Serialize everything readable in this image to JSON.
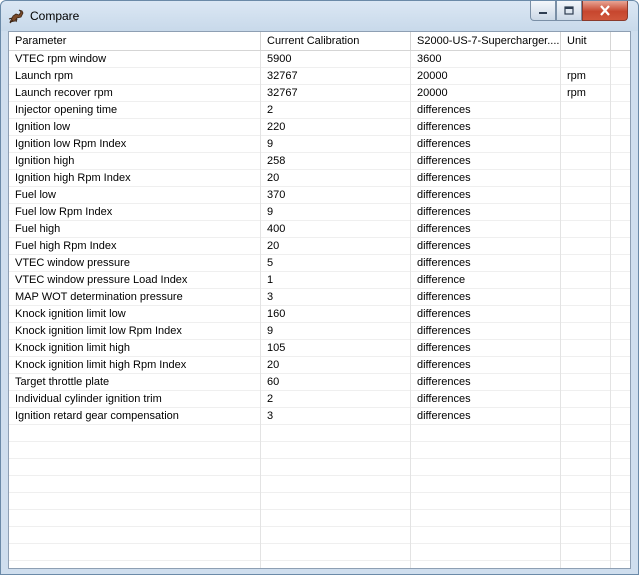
{
  "window": {
    "title": "Compare",
    "icon": "scorpion-app-icon",
    "controls": {
      "minimize": "minimize-icon",
      "maximize": "maximize-icon",
      "close": "close-icon"
    }
  },
  "table": {
    "columns": [
      "Parameter",
      "Current Calibration",
      "S2000-US-7-Supercharger....",
      "Unit"
    ],
    "rows": [
      [
        "VTEC rpm window",
        "5900",
        "3600",
        ""
      ],
      [
        "Launch rpm",
        "32767",
        "20000",
        "rpm"
      ],
      [
        "Launch recover rpm",
        "32767",
        "20000",
        "rpm"
      ],
      [
        "Injector opening time",
        "2",
        "differences",
        ""
      ],
      [
        "Ignition low",
        "220",
        "differences",
        ""
      ],
      [
        "Ignition low Rpm Index",
        "9",
        "differences",
        ""
      ],
      [
        "Ignition high",
        "258",
        "differences",
        ""
      ],
      [
        "Ignition high Rpm Index",
        "20",
        "differences",
        ""
      ],
      [
        "Fuel low",
        "370",
        "differences",
        ""
      ],
      [
        "Fuel low Rpm Index",
        "9",
        "differences",
        ""
      ],
      [
        "Fuel high",
        "400",
        "differences",
        ""
      ],
      [
        "Fuel high Rpm Index",
        "20",
        "differences",
        ""
      ],
      [
        "VTEC window pressure",
        "5",
        "differences",
        ""
      ],
      [
        "VTEC window pressure Load Index",
        "1",
        "difference",
        ""
      ],
      [
        "MAP WOT determination pressure",
        "3",
        "differences",
        ""
      ],
      [
        "Knock ignition limit low",
        "160",
        "differences",
        ""
      ],
      [
        "Knock ignition limit low Rpm Index",
        "9",
        "differences",
        ""
      ],
      [
        "Knock ignition limit high",
        "105",
        "differences",
        ""
      ],
      [
        "Knock ignition limit high Rpm Index",
        "20",
        "differences",
        ""
      ],
      [
        "Target throttle plate",
        "60",
        "differences",
        ""
      ],
      [
        "Individual cylinder ignition trim",
        "2",
        "differences",
        ""
      ],
      [
        "Ignition retard gear compensation",
        "3",
        "differences",
        ""
      ]
    ],
    "empty_rows": 9
  }
}
